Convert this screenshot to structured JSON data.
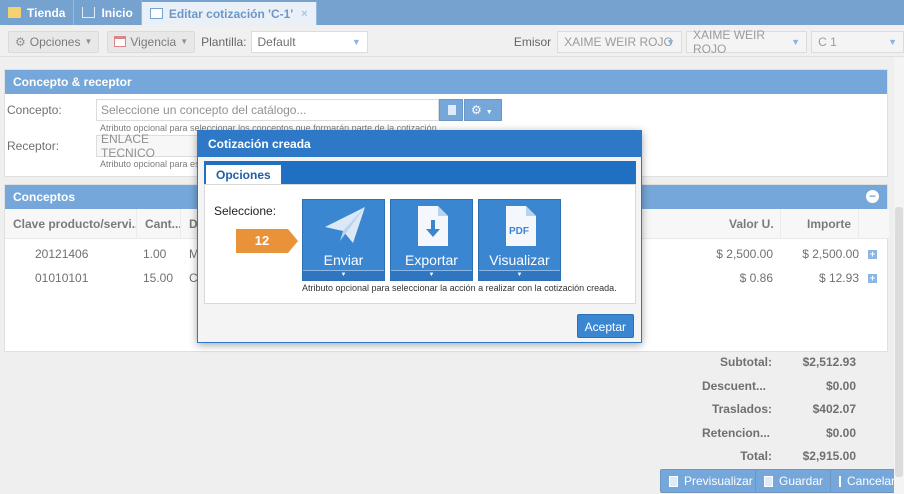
{
  "tabs": [
    {
      "label": "Tienda",
      "icon": "store-icon"
    },
    {
      "label": "Inicio",
      "icon": "home-icon"
    },
    {
      "label": "Editar cotización 'C-1'",
      "icon": "form-icon",
      "close": "×"
    }
  ],
  "toolbar": {
    "opciones": "Opciones",
    "vigencia": "Vigencia",
    "plantilla_label": "Plantilla:",
    "plantilla_value": "Default",
    "emisor_label": "Emisor",
    "emisor_value_1": "XAIME WEIR ROJO",
    "emisor_value_2": "XAIME WEIR ROJO",
    "serie_value": "C 1"
  },
  "concepto_receptor": {
    "title": "Concepto & receptor",
    "concepto_label": "Concepto:",
    "concepto_placeholder": "Seleccione un concepto del catálogo...",
    "concepto_hint": "Atributo opcional para seleccionar los conceptos que formarán parte de la cotización.",
    "receptor_label": "Receptor:",
    "receptor_value": "ENLACE TECNICO",
    "receptor_hint": "Atributo opcional para espe"
  },
  "conceptos": {
    "title": "Conceptos",
    "columns": [
      "Clave producto/servi...",
      "Cant...",
      "D",
      "Valor U.",
      "Importe"
    ],
    "rows": [
      {
        "clave": "20121406",
        "cantidad": "1.00",
        "desc": "M",
        "valor": "$ 2,500.00",
        "importe": "$ 2,500.00"
      },
      {
        "clave": "01010101",
        "cantidad": "15.00",
        "desc": "C",
        "valor": "$ 0.86",
        "importe": "$ 12.93"
      }
    ]
  },
  "totals": [
    {
      "label": "Subtotal:",
      "value": "$2,512.93"
    },
    {
      "label": "Descuent...",
      "value": "$0.00"
    },
    {
      "label": "Traslados:",
      "value": "$402.07"
    },
    {
      "label": "Retencion...",
      "value": "$0.00"
    },
    {
      "label": "Total:",
      "value": "$2,915.00"
    }
  ],
  "bottom_buttons": {
    "previsualizar": "Previsualizar",
    "guardar": "Guardar",
    "cancelar": "Cancelar"
  },
  "modal": {
    "title": "Cotización creada",
    "tab": "Opciones",
    "seleccione": "Seleccione:",
    "step": "12",
    "actions": [
      {
        "label": "Enviar",
        "icon": "paper-plane-icon"
      },
      {
        "label": "Exportar",
        "icon": "download-file-icon"
      },
      {
        "label": "Visualizar",
        "icon": "pdf-file-icon"
      }
    ],
    "pdf_text": "PDF",
    "hint": "Atributo opcional para seleccionar la acción a realizar con la cotización creada.",
    "accept": "Aceptar"
  },
  "colors": {
    "primary": "#2d79c7",
    "step_badge": "#e8923a"
  }
}
